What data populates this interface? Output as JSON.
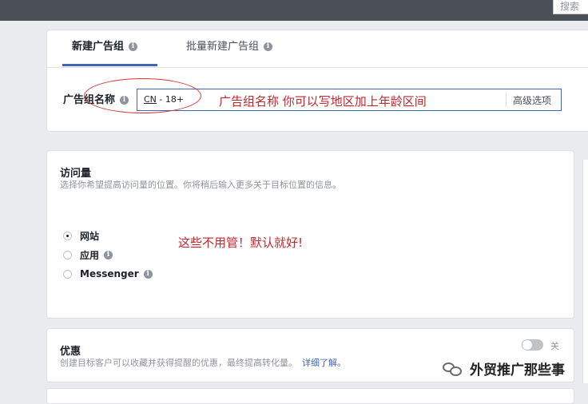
{
  "topbar": {
    "search_label": "搜索"
  },
  "tabs": [
    {
      "label": "新建广告组",
      "active": true
    },
    {
      "label": "批量新建广告组",
      "active": false
    }
  ],
  "adset_name": {
    "label": "广告组名称",
    "value_country": "CN",
    "value_rest": " - 18+",
    "advanced_button": "高级选项"
  },
  "annotations": {
    "name_hint": "广告组名称 你可以写地区加上年龄区间",
    "traffic_hint": "这些不用管！默认就好!"
  },
  "traffic": {
    "title": "访问量",
    "description": "选择你希望提高访问量的位置。你将稍后输入更多关于目标位置的信息。",
    "options": [
      {
        "label": "网站",
        "selected": true,
        "info": false
      },
      {
        "label": "应用",
        "selected": false,
        "info": true
      },
      {
        "label": "Messenger",
        "selected": false,
        "info": true
      }
    ]
  },
  "offers": {
    "title": "优惠",
    "description": "创建目标客户可以收藏并获得提醒的优惠，最终提高转化量。",
    "link": "详细了解。",
    "toggle_label": "关",
    "toggle_on": false
  },
  "watermark": {
    "text": "外贸推广那些事"
  },
  "colors": {
    "accent": "#4267b2",
    "annotation": "#c0282d",
    "topbar": "#4b4f56"
  }
}
